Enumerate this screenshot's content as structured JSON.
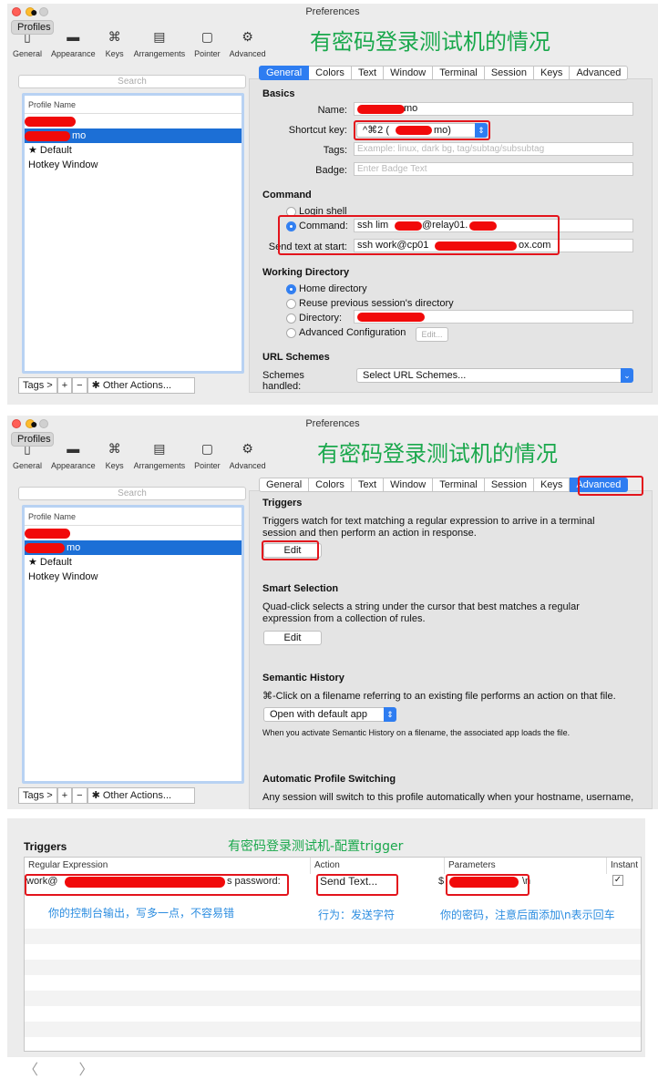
{
  "window_title": "Preferences",
  "banner_text": "有密码登录测试机的情况",
  "toolbar": [
    "General",
    "Appearance",
    "Profiles",
    "Keys",
    "Arrangements",
    "Pointer",
    "Advanced"
  ],
  "search_placeholder": "Search",
  "profile_list": {
    "header": "Profile Name",
    "default": "★ Default",
    "hotkey": "Hotkey Window",
    "selected_suffix": "mo"
  },
  "bottom_bar": {
    "tags": "Tags >",
    "plus": "+",
    "minus": "−",
    "other": "✱ Other Actions...",
    "chev": "⌄"
  },
  "tabs": [
    "General",
    "Colors",
    "Text",
    "Window",
    "Terminal",
    "Session",
    "Keys",
    "Advanced"
  ],
  "general": {
    "basics_h": "Basics",
    "name_lbl": "Name:",
    "name_val": "mo",
    "shortcut_lbl": "Shortcut key:",
    "shortcut_val": "^⌘2 (",
    "shortcut_tail": "mo)",
    "tags_lbl": "Tags:",
    "tags_ph": "Example: linux, dark bg, tag/subtag/subsubtag",
    "badge_lbl": "Badge:",
    "badge_ph": "Enter Badge Text",
    "command_h": "Command",
    "login_shell": "Login shell",
    "command_lbl": "Command:",
    "command_val": "ssh lim",
    "command_tail": "@relay01.",
    "send_lbl": "Send text at start:",
    "send_val": "ssh work@cp01",
    "send_tail": "ox.com",
    "wd_h": "Working Directory",
    "home": "Home directory",
    "reuse": "Reuse previous session's directory",
    "dir": "Directory:",
    "adv_conf": "Advanced Configuration",
    "edit": "Edit...",
    "url_h": "URL Schemes",
    "schemes_lbl": "Schemes handled:",
    "schemes_val": "Select URL Schemes..."
  },
  "advanced": {
    "triggers_h": "Triggers",
    "triggers_p": "Triggers watch for text matching a regular expression to arrive in a terminal session and then perform an action in response.",
    "edit": "Edit",
    "smart_h": "Smart Selection",
    "smart_p": "Quad-click selects a string under the cursor that best matches a regular expression from a collection of rules.",
    "semantic_h": "Semantic History",
    "semantic_p": "⌘-Click on a filename referring to an existing file performs an action on that file.",
    "semantic_sel": "Open with default app",
    "semantic_note": "When you activate Semantic History on a filename, the associated app loads the file.",
    "auto_h": "Automatic Profile Switching",
    "auto_p": "Any session will switch to this profile automatically when your hostname, username,"
  },
  "trigger_panel": {
    "title": "Triggers",
    "caption": "有密码登录测试机-配置trigger",
    "headers": [
      "Regular Expression",
      "Action",
      "Parameters",
      "Instant"
    ],
    "regex_head": "work@",
    "regex_tail": "s password:",
    "action": "Send Text...",
    "param_head": "$",
    "param_tail": "\\n",
    "instant": "✓",
    "note_regex": "你的控制台输出，写多一点，不容易错",
    "note_action": "行为：发送字符",
    "note_param": "你的密码，注意后面添加\\n表示回车"
  },
  "nav": {
    "back": "〈",
    "fwd": "〉"
  }
}
